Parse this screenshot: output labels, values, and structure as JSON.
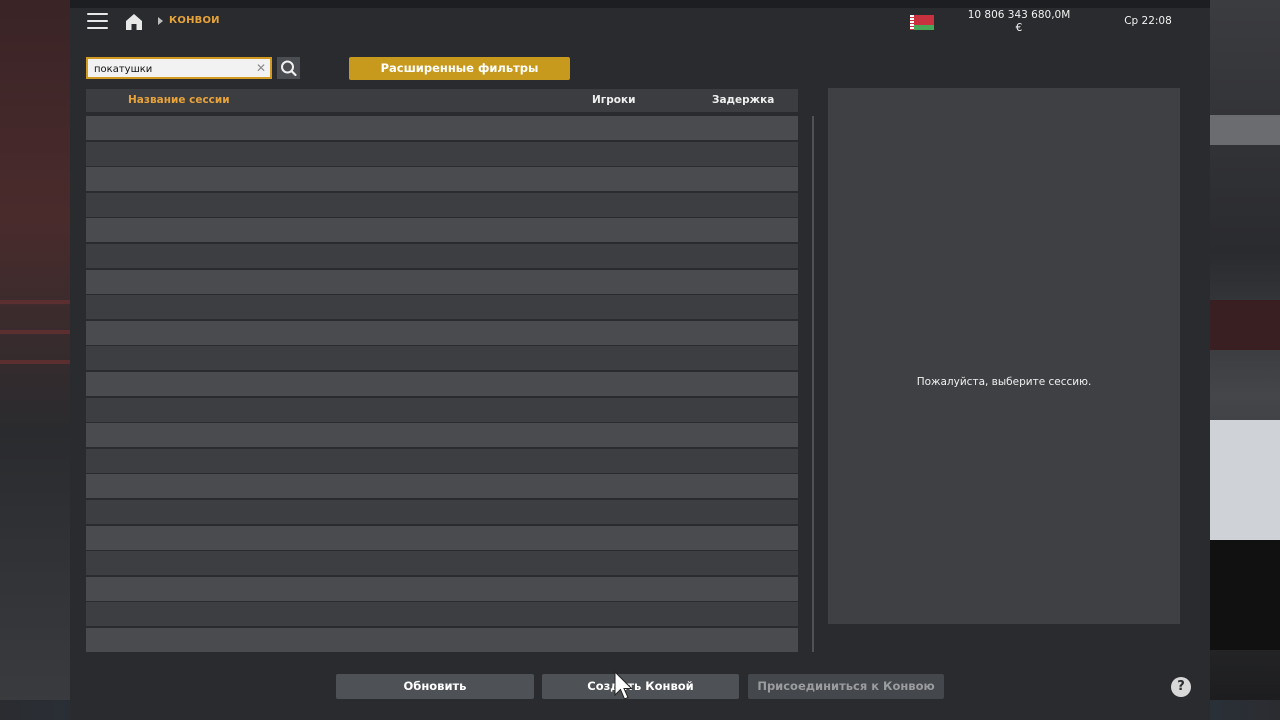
{
  "header": {
    "breadcrumb": "КОНВОИ",
    "currency_amount": "10 806 343 680,0M",
    "currency_symbol": "€",
    "clock": "Ср 22:08",
    "flag": "belarus-flag"
  },
  "search": {
    "value": "покатушки",
    "filters_label": "Расширенные фильтры"
  },
  "table": {
    "columns": [
      "Название сессии",
      "Игроки",
      "Задержка"
    ],
    "rows": []
  },
  "details": {
    "empty_message": "Пожалуйста, выберите сессию."
  },
  "actions": {
    "refresh": "Обновить",
    "create": "Создать Конвой",
    "join": "Присоединиться к Конвою",
    "help": "?"
  },
  "colors": {
    "accent": "#e8a33a",
    "button_gold": "#c79a1d",
    "panel": "#2a2b2e"
  }
}
